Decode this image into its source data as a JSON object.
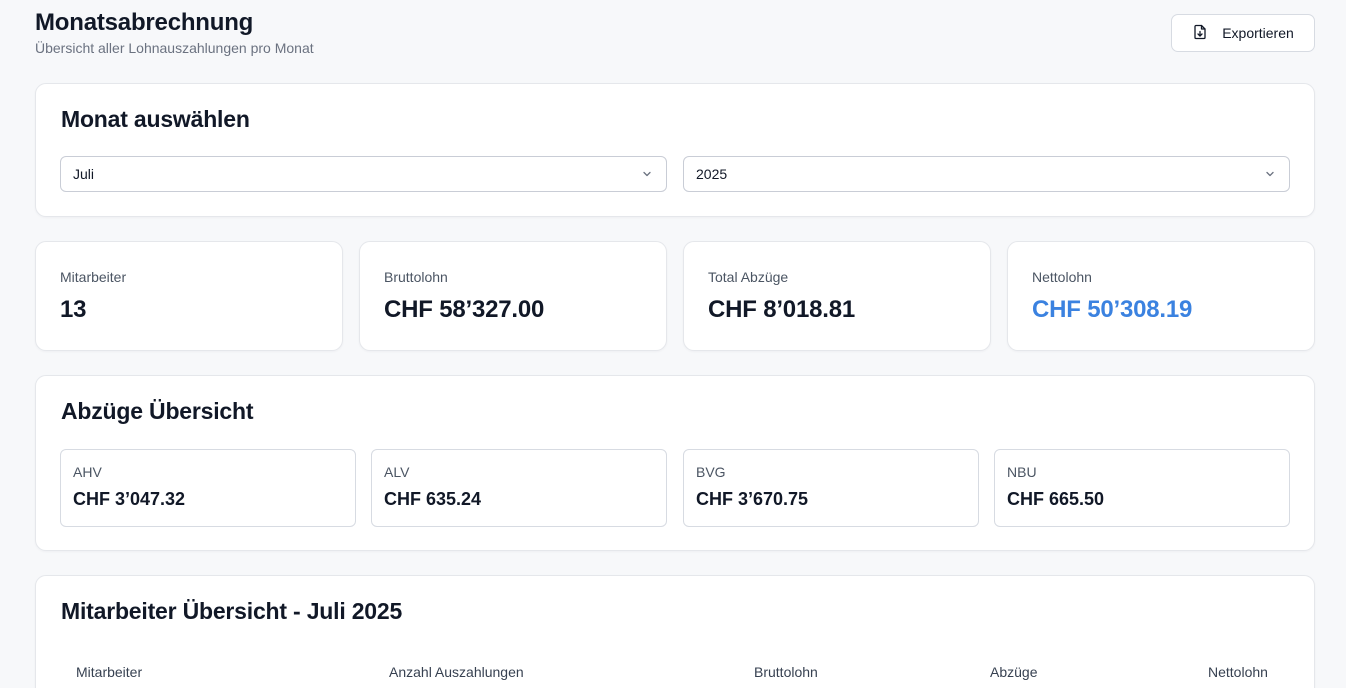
{
  "header": {
    "title": "Monatsabrechnung",
    "subtitle": "Übersicht aller Lohnauszahlungen pro Monat",
    "export_label": "Exportieren",
    "export_icon": "file-export-icon"
  },
  "month_selector": {
    "title": "Monat auswählen",
    "month_value": "Juli",
    "year_value": "2025",
    "chevron_icon": "chevron-down-icon"
  },
  "stats": [
    {
      "label": "Mitarbeiter",
      "value": "13"
    },
    {
      "label": "Bruttolohn",
      "value": "CHF 58’327.00"
    },
    {
      "label": "Total Abzüge",
      "value": "CHF 8’018.81"
    },
    {
      "label": "Nettolohn",
      "value": "CHF 50’308.19"
    }
  ],
  "deductions": {
    "title": "Abzüge Übersicht",
    "items": [
      {
        "label": "AHV",
        "value": "CHF 3’047.32"
      },
      {
        "label": "ALV",
        "value": "CHF 635.24"
      },
      {
        "label": "BVG",
        "value": "CHF 3’670.75"
      },
      {
        "label": "NBU",
        "value": "CHF 665.50"
      }
    ]
  },
  "employee_overview": {
    "title": "Mitarbeiter Übersicht - Juli 2025",
    "columns": [
      "Mitarbeiter",
      "Anzahl Auszahlungen",
      "Bruttolohn",
      "Abzüge",
      "Nettolohn"
    ]
  },
  "colors": {
    "accent": "#3b82e0",
    "text": "#111827",
    "muted": "#6b7280",
    "background": "#f7f8fa",
    "card": "#ffffff"
  }
}
